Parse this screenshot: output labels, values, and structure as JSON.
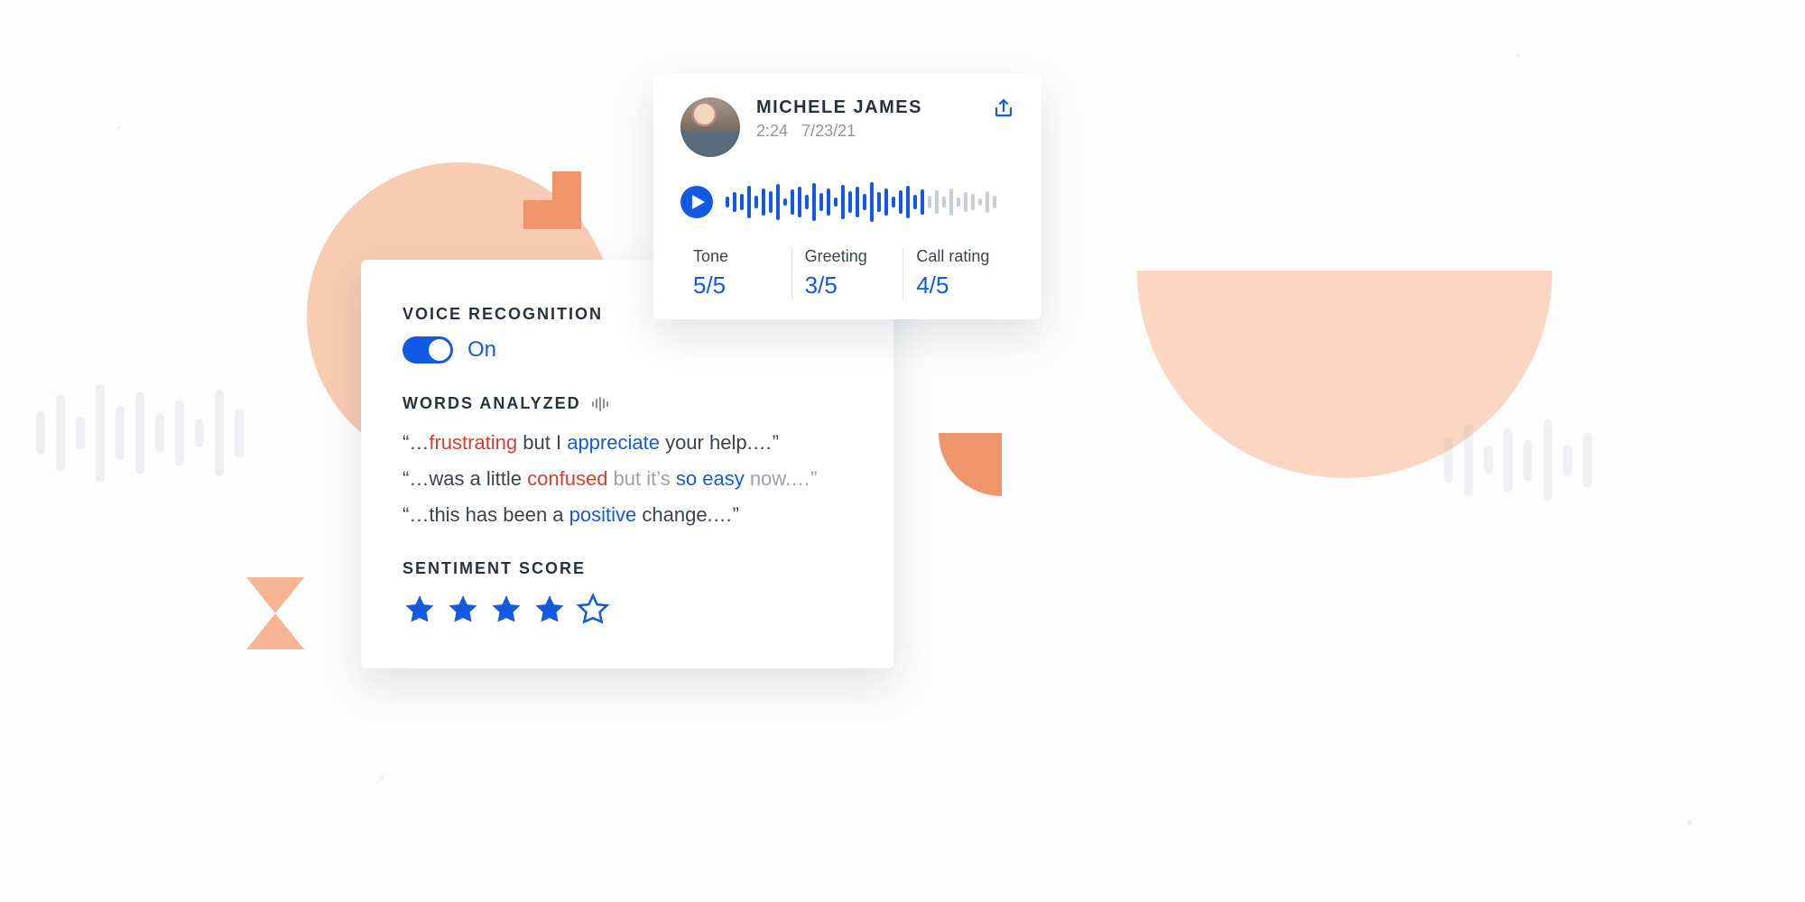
{
  "colors": {
    "accent": "#125ae5",
    "negative": "#e03a2a",
    "positive": "#125ae5",
    "peach": "#f9cbb2"
  },
  "analysis": {
    "voice_recognition_label": "VOICE RECOGNITION",
    "toggle_state_label": "On",
    "toggle_on": true,
    "words_analyzed_label": "WORDS ANALYZED",
    "quotes": [
      {
        "segments": [
          {
            "t": "“…",
            "c": "plain"
          },
          {
            "t": "frustrating",
            "c": "neg"
          },
          {
            "t": " but I ",
            "c": "plain"
          },
          {
            "t": "appreciate",
            "c": "pos"
          },
          {
            "t": " your help.…”",
            "c": "plain"
          }
        ]
      },
      {
        "segments": [
          {
            "t": "“…was a little ",
            "c": "plain"
          },
          {
            "t": "confused",
            "c": "neg"
          },
          {
            "t": " but it’s ",
            "c": "muted"
          },
          {
            "t": "so easy",
            "c": "pos"
          },
          {
            "t": " now.…”",
            "c": "muted"
          }
        ]
      },
      {
        "segments": [
          {
            "t": "“…this has been a ",
            "c": "plain"
          },
          {
            "t": "positive",
            "c": "pos"
          },
          {
            "t": " change.…”",
            "c": "plain"
          }
        ]
      }
    ],
    "sentiment_label": "SENTIMENT SCORE",
    "sentiment_stars_filled": 4,
    "sentiment_stars_total": 5
  },
  "call": {
    "name": "MICHELE JAMES",
    "duration": "2:24",
    "date": "7/23/21",
    "metrics": [
      {
        "label": "Tone",
        "value": "5/5"
      },
      {
        "label": "Greeting",
        "value": "3/5"
      },
      {
        "label": "Call rating",
        "value": "4/5"
      }
    ],
    "waveform_heights_played": [
      12,
      22,
      18,
      36,
      14,
      30,
      24,
      40,
      8,
      28,
      34,
      16,
      42,
      20,
      30,
      10,
      38,
      24,
      34,
      18,
      44,
      22,
      30,
      12,
      26,
      36,
      16,
      28
    ],
    "waveform_heights_remaining": [
      14,
      26,
      12,
      30,
      10,
      22,
      18,
      8,
      24,
      14
    ]
  }
}
